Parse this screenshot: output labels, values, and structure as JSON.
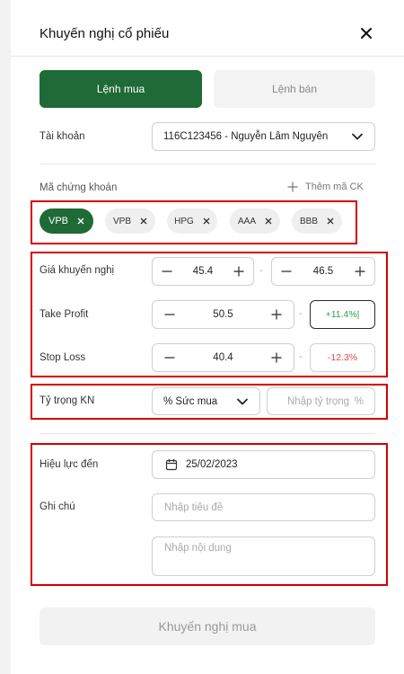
{
  "header": {
    "title": "Khuyến nghị cổ phiếu"
  },
  "tabs": {
    "buy": "Lệnh mua",
    "sell": "Lệnh bán"
  },
  "account": {
    "label": "Tài khoản",
    "value": "116C123456 - Nguyễn Lâm Nguyên"
  },
  "stock": {
    "label": "Mã chứng khoán",
    "add_label": "Thêm mã CK",
    "chips": [
      "VPB",
      "VPB",
      "HPG",
      "AAA",
      "BBB"
    ]
  },
  "price": {
    "label": "Giá khuyến nghị",
    "min": "45.4",
    "max": "46.5"
  },
  "take_profit": {
    "label": "Take Profit",
    "value": "50.5",
    "pct": "+11.4%|"
  },
  "stop_loss": {
    "label": "Stop Loss",
    "value": "40.4",
    "pct": "-12.3%"
  },
  "ratio": {
    "label": "Tỷ trọng KN",
    "select": "% Sức mua",
    "placeholder": "Nhập tỷ trọng",
    "unit": "%"
  },
  "validity": {
    "label": "Hiệu lực đến",
    "date": "25/02/2023"
  },
  "note": {
    "label": "Ghi chú",
    "title_placeholder": "Nhập tiêu đề",
    "content_placeholder": "Nhập nội dung"
  },
  "separator": "-",
  "submit": {
    "label": "Khuyến nghị mua"
  },
  "colors": {
    "primary": "#1f6a36",
    "positive": "#2e9e4f",
    "negative": "#e04848",
    "highlight": "#d40000"
  },
  "icons": {
    "close": "close-icon",
    "chevron": "chevron-down-icon",
    "plus": "plus-icon",
    "minus": "minus-icon",
    "calendar": "calendar-icon"
  }
}
